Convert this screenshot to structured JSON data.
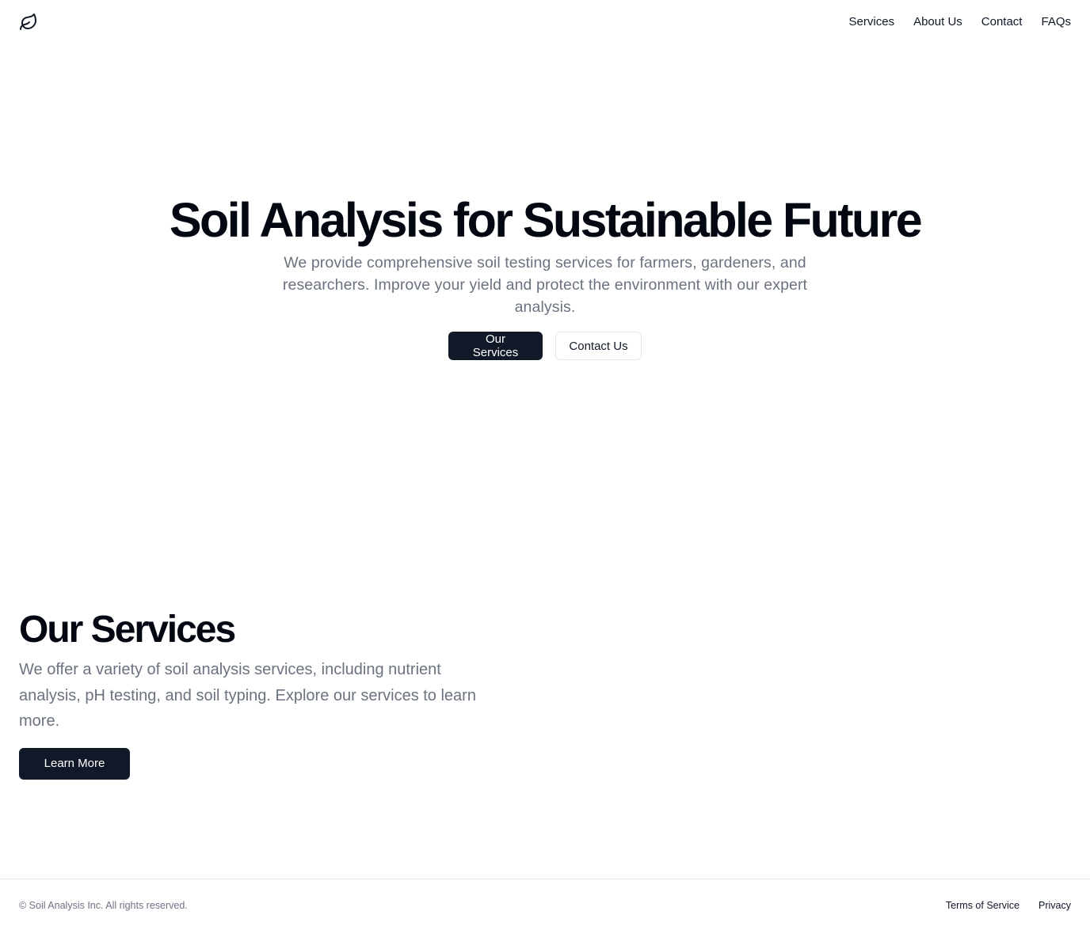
{
  "header": {
    "logo_icon": "leaf-icon",
    "nav": [
      {
        "label": "Services"
      },
      {
        "label": "About Us"
      },
      {
        "label": "Contact"
      },
      {
        "label": "FAQs"
      }
    ]
  },
  "hero": {
    "title": "Soil Analysis for Sustainable Future",
    "subtitle": "We provide comprehensive soil testing services for farmers, gardeners, and researchers. Improve your yield and protect the environment with our expert analysis.",
    "primary_button": "Our Services",
    "secondary_button": "Contact Us"
  },
  "services": {
    "title": "Our Services",
    "description": "We offer a variety of soil analysis services, including nutrient analysis, pH testing, and soil typing. Explore our services to learn more.",
    "button": "Learn More"
  },
  "footer": {
    "copyright": "© Soil Analysis Inc. All rights reserved.",
    "links": [
      {
        "label": "Terms of Service"
      },
      {
        "label": "Privacy"
      }
    ]
  },
  "colors": {
    "primary_dark": "#111827",
    "muted_text": "#6b7280",
    "border": "#e5e7eb",
    "background": "#ffffff"
  }
}
